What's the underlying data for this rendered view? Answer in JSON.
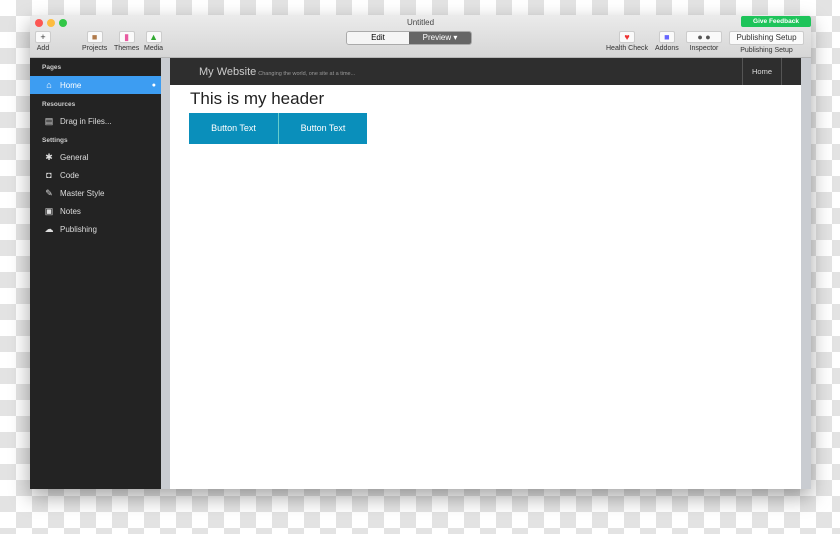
{
  "window": {
    "title": "Untitled"
  },
  "toolbar": {
    "add": "Add",
    "projects": "Projects",
    "themes": "Themes",
    "media": "Media",
    "edit": "Edit",
    "preview": "Preview",
    "health_check": "Health Check",
    "addons": "Addons",
    "inspector": "Inspector",
    "publishing_setup_button": "Publishing Setup",
    "publishing_setup_label": "Publishing Setup",
    "give_feedback": "Give Feedback"
  },
  "sidebar": {
    "pages_header": "Pages",
    "home": "Home",
    "resources_header": "Resources",
    "drag_files": "Drag in Files...",
    "settings_header": "Settings",
    "items": [
      {
        "label": "General",
        "icon": "gear-icon"
      },
      {
        "label": "Code",
        "icon": "code-icon"
      },
      {
        "label": "Master Style",
        "icon": "eyedropper-icon"
      },
      {
        "label": "Notes",
        "icon": "notes-icon"
      },
      {
        "label": "Publishing",
        "icon": "cloud-icon"
      }
    ]
  },
  "site": {
    "name": "My Website",
    "tagline": "Changing the world, one site at a time...",
    "nav_home": "Home",
    "header": "This is my header",
    "buttons": [
      "Button Text",
      "Button Text"
    ]
  },
  "colors": {
    "accent": "#3d9df2",
    "button": "#0a8fbb",
    "feedback": "#1ec45a"
  }
}
